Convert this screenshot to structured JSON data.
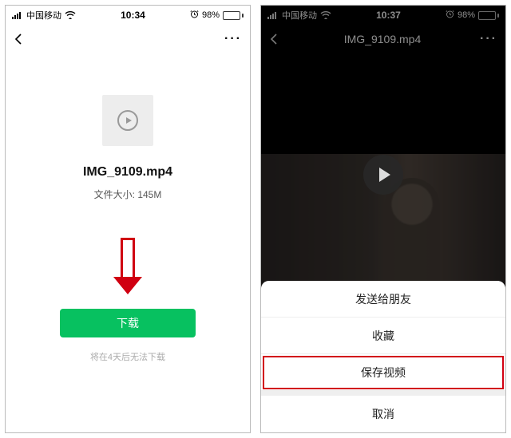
{
  "screen1": {
    "status": {
      "carrier": "中国移动",
      "time": "10:34",
      "battery_pct": "98%"
    },
    "nav": {
      "back_icon": "chevron-left",
      "more_icon": "···"
    },
    "file": {
      "thumb_icon": "play-circle",
      "name": "IMG_9109.mp4",
      "size_label": "文件大小: 145M"
    },
    "annotation": "red-down-arrow",
    "download_btn": "下载",
    "expire_note": "将在4天后无法下载"
  },
  "screen2": {
    "status": {
      "carrier": "中国移动",
      "time": "10:37",
      "battery_pct": "98%"
    },
    "nav": {
      "back_icon": "chevron-left",
      "title": "IMG_9109.mp4",
      "more_icon": "···"
    },
    "player": {
      "big_play_icon": "play-circle"
    },
    "action_sheet": {
      "options": [
        {
          "label": "发送给朋友"
        },
        {
          "label": "收藏"
        },
        {
          "label": "保存视频",
          "highlight": true
        }
      ],
      "cancel": "取消"
    }
  },
  "colors": {
    "accent_green": "#07c160",
    "annotation_red": "#d00011"
  }
}
